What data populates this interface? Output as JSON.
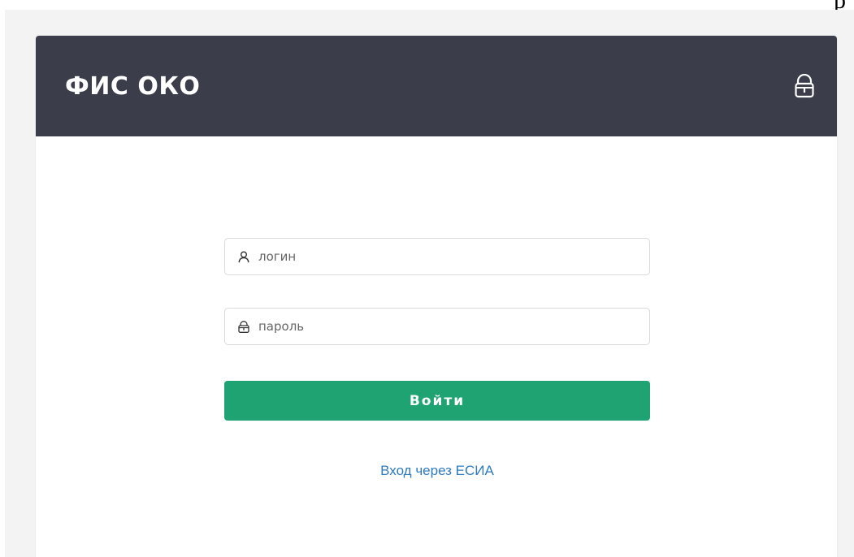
{
  "stray_glyph": "р",
  "header": {
    "title": "ФИС ОКО",
    "lock_icon": "lock-icon"
  },
  "login_form": {
    "login": {
      "icon": "user-icon",
      "placeholder": "логин",
      "value": ""
    },
    "password": {
      "icon": "lock-icon",
      "placeholder": "пароль",
      "value": ""
    },
    "submit_label": "Войти",
    "esia_link_label": "Вход через ЕСИА"
  },
  "colors": {
    "header_bg": "#3b3e4a",
    "accent": "#1fa373",
    "link": "#2f7bbf",
    "page_bg": "#f3f3f3"
  }
}
